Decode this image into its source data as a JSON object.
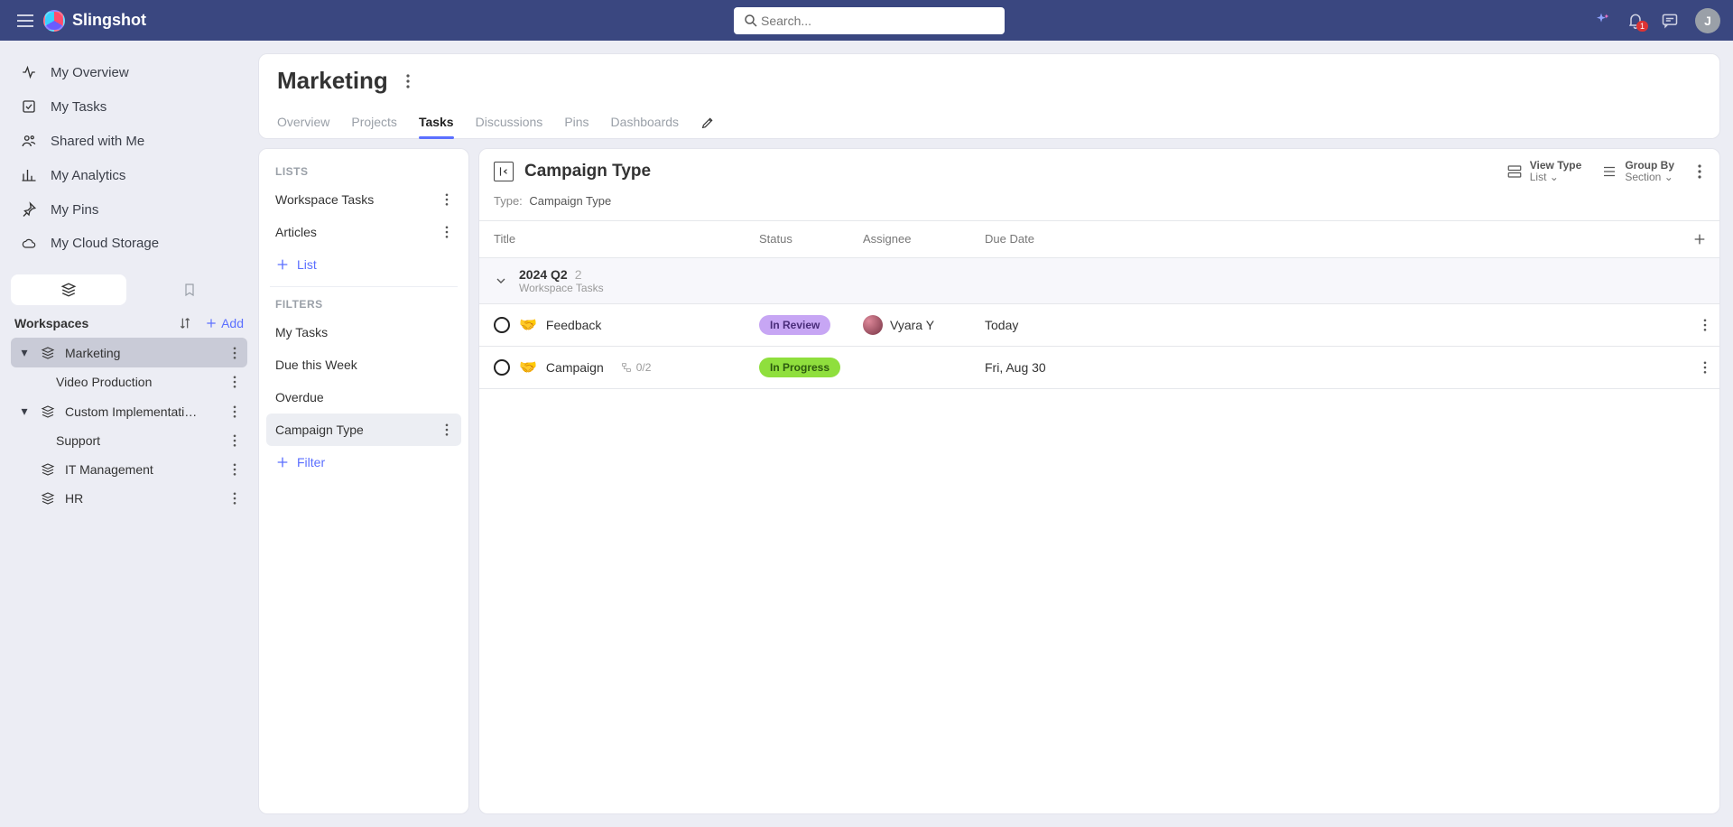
{
  "brand": "Slingshot",
  "search": {
    "placeholder": "Search..."
  },
  "notif": {
    "count": "1"
  },
  "avatar": {
    "initial": "J"
  },
  "nav": [
    {
      "icon": "overview",
      "label": "My Overview"
    },
    {
      "icon": "tasks",
      "label": "My Tasks"
    },
    {
      "icon": "shared",
      "label": "Shared with Me"
    },
    {
      "icon": "analytics",
      "label": "My Analytics"
    },
    {
      "icon": "pins",
      "label": "My Pins"
    },
    {
      "icon": "cloud",
      "label": "My Cloud Storage"
    }
  ],
  "wsHeader": {
    "title": "Workspaces",
    "add": "Add"
  },
  "workspaces": [
    {
      "label": "Marketing",
      "children": [
        {
          "label": "Video Production"
        }
      ]
    },
    {
      "label": "Custom Implementati…",
      "children": [
        {
          "label": "Support"
        }
      ]
    },
    {
      "label": "IT Management"
    },
    {
      "label": "HR"
    }
  ],
  "page": {
    "title": "Marketing",
    "tabs": [
      "Overview",
      "Projects",
      "Tasks",
      "Discussions",
      "Pins",
      "Dashboards"
    ]
  },
  "leftPanel": {
    "listsLabel": "LISTS",
    "lists": [
      "Workspace Tasks",
      "Articles"
    ],
    "addList": "List",
    "filtersLabel": "FILTERS",
    "filters": [
      "My Tasks",
      "Due this Week",
      "Overdue",
      "Campaign Type"
    ],
    "addFilter": "Filter"
  },
  "board": {
    "title": "Campaign Type",
    "typeLabel": "Type:",
    "typeValue": "Campaign Type",
    "viewType": {
      "label": "View Type",
      "value": "List"
    },
    "groupBy": {
      "label": "Group By",
      "value": "Section"
    },
    "columns": {
      "title": "Title",
      "status": "Status",
      "assignee": "Assignee",
      "due": "Due Date"
    },
    "group": {
      "name": "2024 Q2",
      "count": "2",
      "sub": "Workspace Tasks"
    },
    "rows": [
      {
        "title": "Feedback",
        "status": "In Review",
        "statusClass": "review",
        "assignee": "Vyara Y",
        "due": "Today",
        "sub": ""
      },
      {
        "title": "Campaign",
        "status": "In Progress",
        "statusClass": "progress",
        "assignee": "",
        "due": "Fri, Aug 30",
        "sub": "0/2"
      }
    ]
  }
}
